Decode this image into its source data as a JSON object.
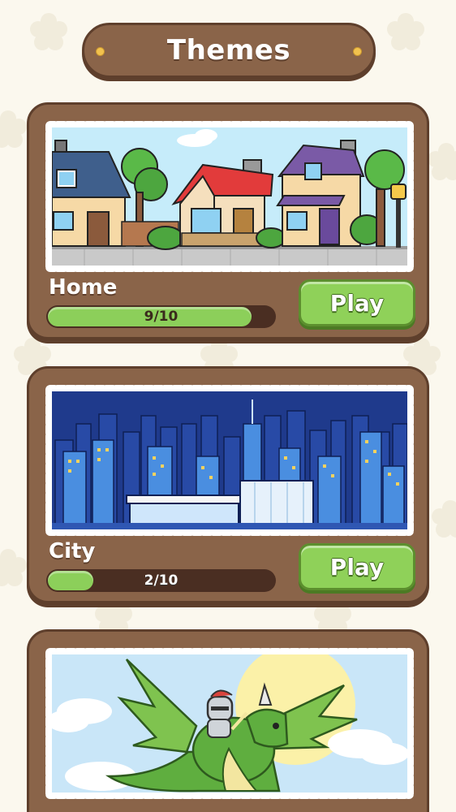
{
  "header": {
    "title": "Themes"
  },
  "themes": [
    {
      "name": "Home",
      "progress_text": "9/10",
      "progress_fraction": 0.9,
      "play_label": "Play",
      "illustration": "houses-illustration"
    },
    {
      "name": "City",
      "progress_text": "2/10",
      "progress_fraction": 0.2,
      "play_label": "Play",
      "illustration": "city-skyline-illustration"
    },
    {
      "name": "",
      "progress_text": "",
      "progress_fraction": null,
      "play_label": "",
      "illustration": "dragon-knight-illustration"
    }
  ],
  "colors": {
    "background": "#fbf8ee",
    "card": "#8a6449",
    "card_border": "#5e3f2c",
    "progress_fill": "#8ccf5a",
    "progress_track": "#4a2e22",
    "play_button": "#8fd159"
  }
}
